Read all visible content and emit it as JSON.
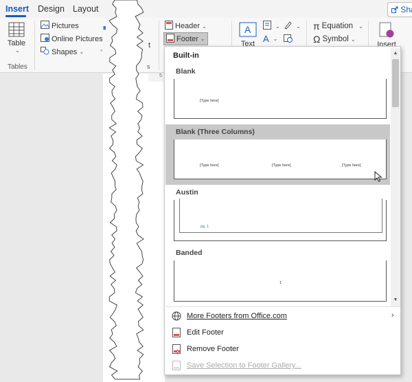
{
  "tabs": {
    "insert": "Insert",
    "design": "Design",
    "layout": "Layout",
    "share": "Sha"
  },
  "ribbon": {
    "table_label": "Table",
    "tables_group_label": "Tables",
    "pictures": "Pictures",
    "online_pictures": "Online Pictures",
    "shapes": "Shapes",
    "header": "Header",
    "footer": "Footer",
    "text": "Text",
    "equation": "Equation",
    "symbol": "Symbol",
    "insert_label": "Insert",
    "ruler_mark": "5"
  },
  "menu": {
    "heading": "Built-in",
    "items": [
      {
        "title": "Blank",
        "placeholders": [
          "[Type here]"
        ]
      },
      {
        "title": "Blank (Three Columns)",
        "placeholders": [
          "[Type here]",
          "[Type here]",
          "[Type here]"
        ]
      },
      {
        "title": "Austin",
        "placeholders": [
          "pg. 1"
        ]
      },
      {
        "title": "Banded",
        "placeholders": [
          "1"
        ]
      }
    ],
    "commands": {
      "more": "More Footers from Office.com",
      "edit": "Edit Footer",
      "remove": "Remove Footer",
      "save": "Save Selection to Footer Gallery..."
    }
  },
  "colors": {
    "accent": "#185abd",
    "highlight": "#c8c8c8"
  }
}
